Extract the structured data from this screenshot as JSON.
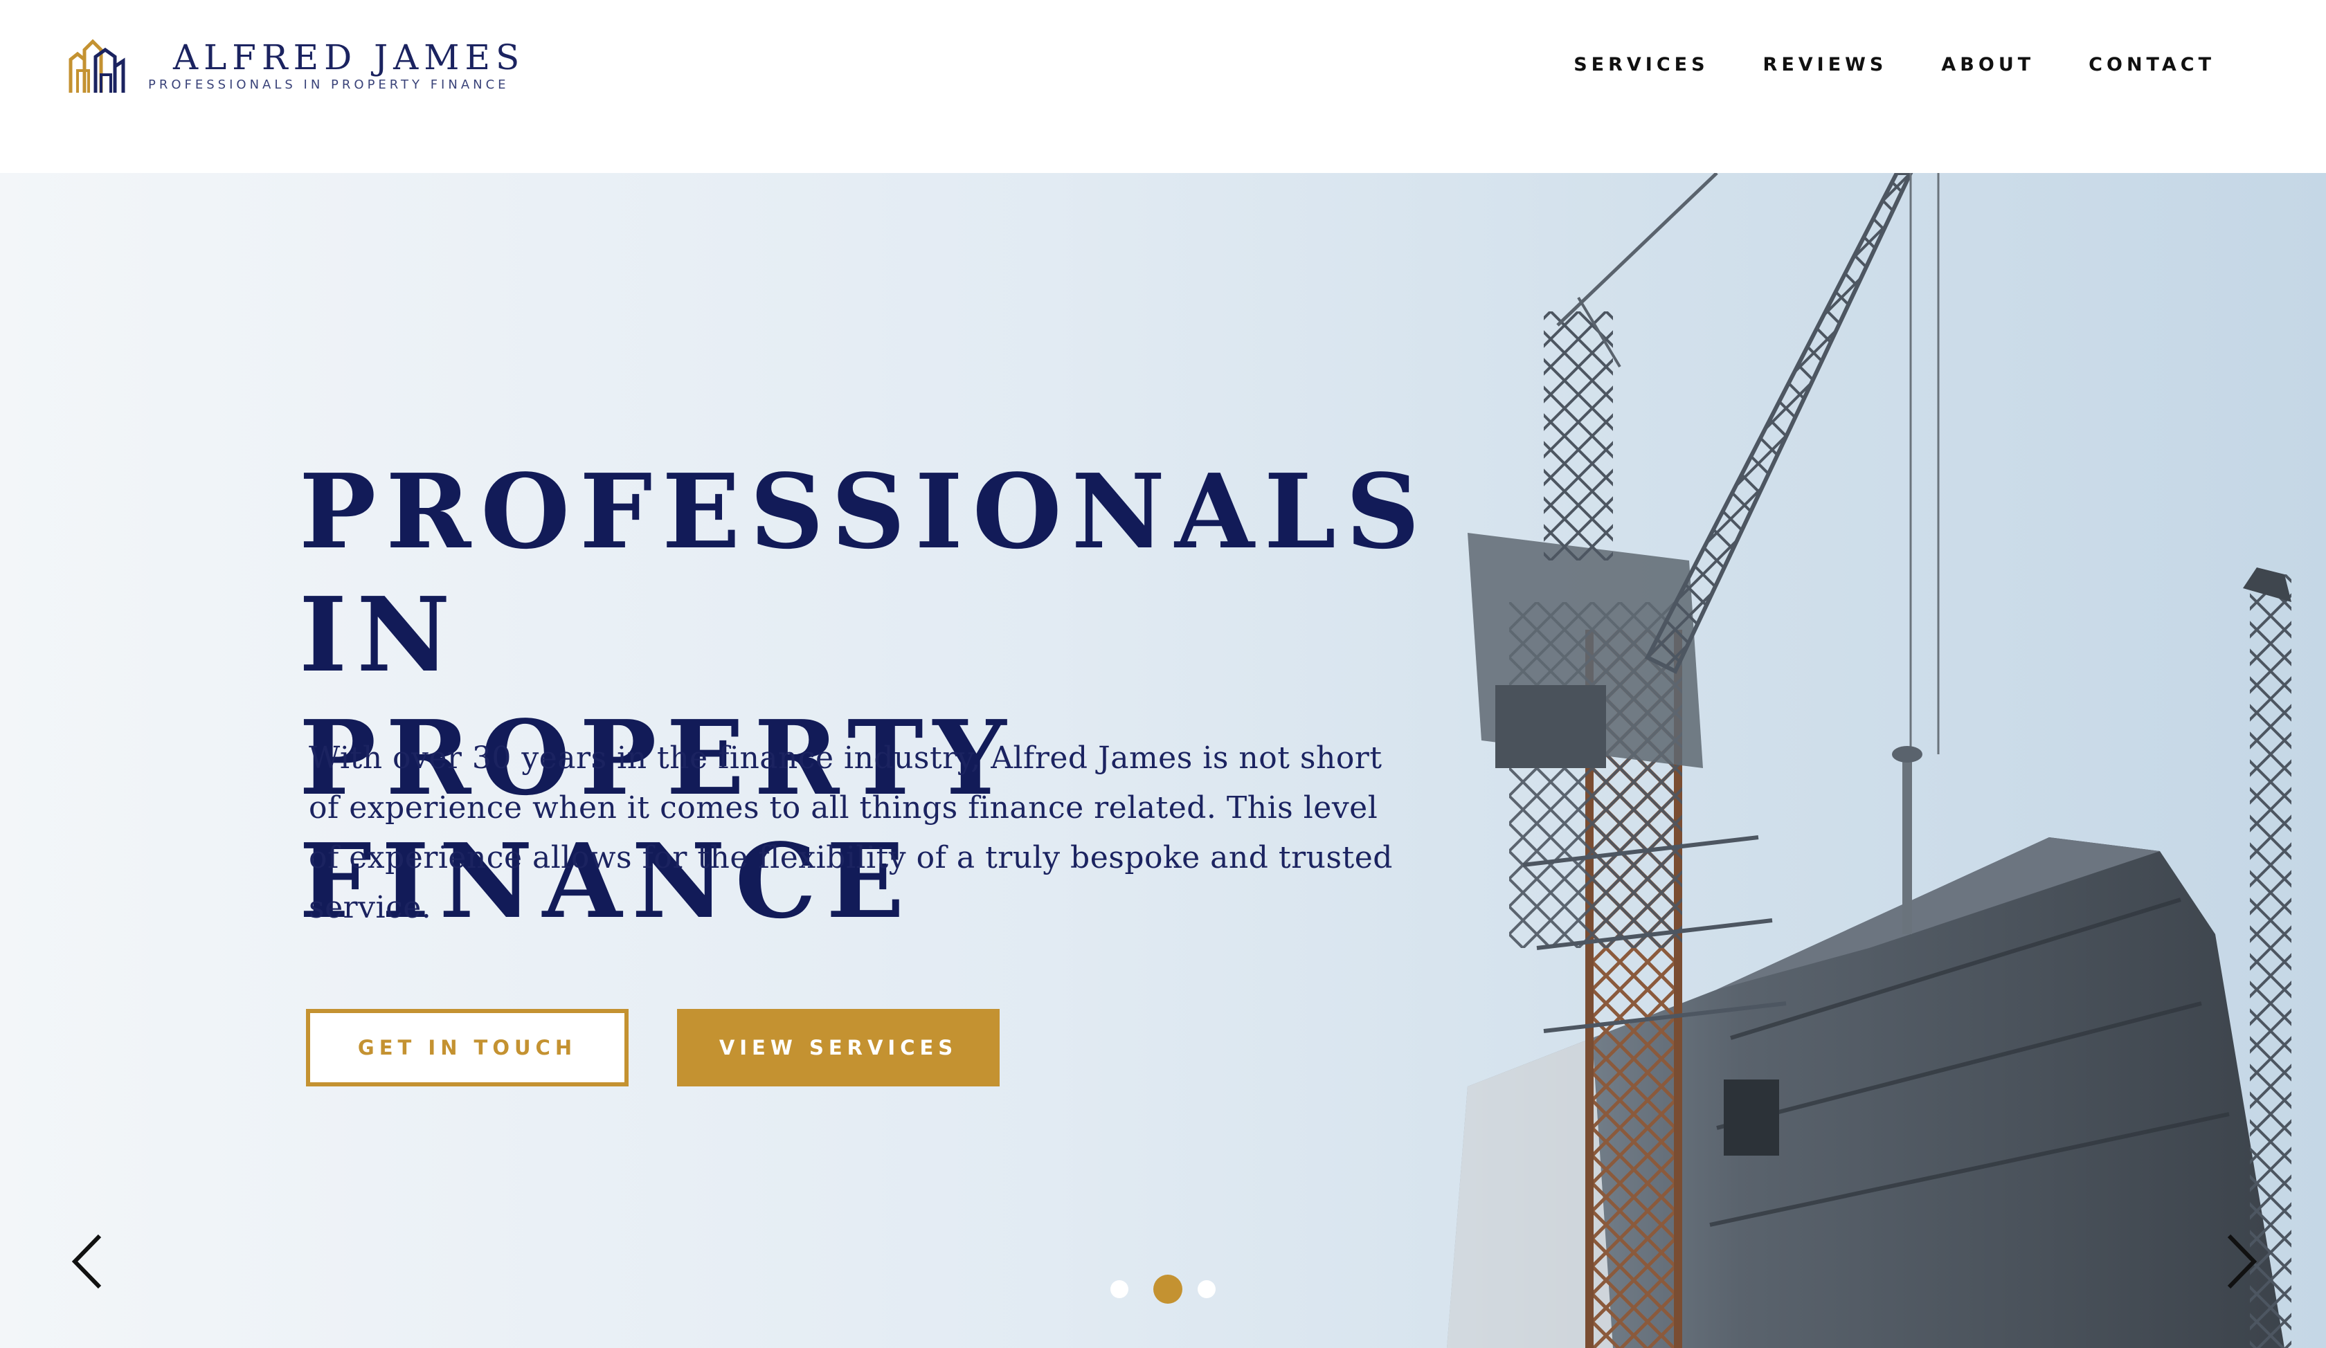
{
  "brand": {
    "name": "ALFRED JAMES",
    "tagline": "PROFESSIONALS IN PROPERTY FINANCE",
    "logo_icon": "buildings-logo-icon",
    "primary_color": "#121b58",
    "accent_color": "#c49231"
  },
  "nav": {
    "items": [
      {
        "label": "SERVICES"
      },
      {
        "label": "REVIEWS"
      },
      {
        "label": "ABOUT"
      },
      {
        "label": "CONTACT"
      }
    ]
  },
  "hero": {
    "title": "PROFESSIONALS IN\nPROPERTY FINANCE",
    "body": "With over 30 years in the finance industry, Alfred James is not short of experience when it comes to all things finance related. This level of experience allows for the flexibility of a truly bespoke and trusted service.",
    "cta_primary": "GET IN TOUCH",
    "cta_secondary": "VIEW SERVICES",
    "background_image": "construction-crane-photo",
    "carousel": {
      "slide_count": 3,
      "active_slide": 2,
      "prev_icon": "chevron-left-icon",
      "next_icon": "chevron-right-icon"
    }
  }
}
